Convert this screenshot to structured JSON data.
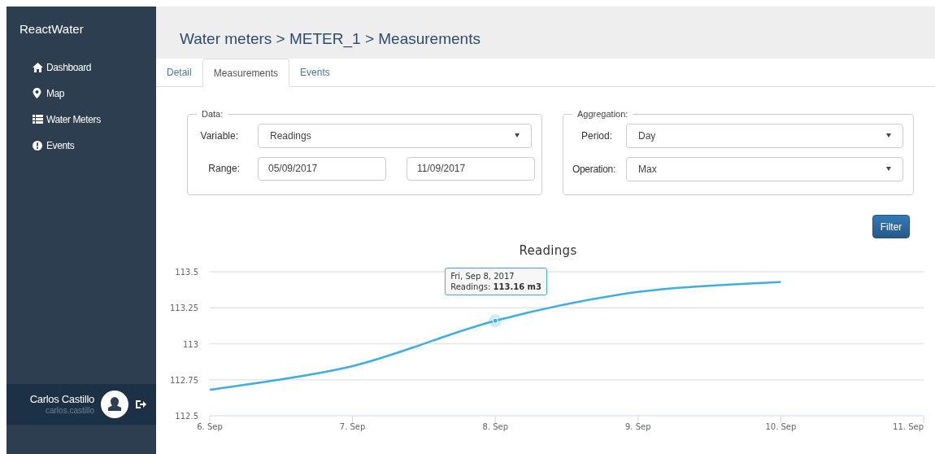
{
  "sidebar": {
    "brand": "ReactWater",
    "items": [
      {
        "kind": "home",
        "label": "Dashboard"
      },
      {
        "kind": "pin",
        "label": "Map"
      },
      {
        "kind": "list",
        "label": "Water Meters"
      },
      {
        "kind": "alert",
        "label": "Events"
      }
    ],
    "user": {
      "name": "Carlos Castillo",
      "username": "carlos.castillo"
    }
  },
  "header": {
    "breadcrumb": "Water meters > METER_1 > Measurements"
  },
  "tabs": [
    {
      "label": "Detail",
      "selected": false
    },
    {
      "label": "Measurements",
      "selected": true
    },
    {
      "label": "Events",
      "selected": false
    }
  ],
  "data_panel": {
    "legend": "Data:",
    "variable": {
      "label": "Variable:",
      "value": "Readings"
    },
    "range": {
      "label": "Range:",
      "from": "05/09/2017",
      "to": "11/09/2017"
    }
  },
  "aggregation_panel": {
    "legend": "Aggregation:",
    "period": {
      "label": "Period:",
      "value": "Day"
    },
    "operation": {
      "label": "Operation:",
      "value": "Max"
    }
  },
  "filter_button": "Filter",
  "chart": {
    "chart_data": {
      "type": "line",
      "title": "Readings",
      "categories": [
        "6. Sep",
        "7. Sep",
        "8. Sep",
        "9. Sep",
        "10. Sep",
        "11. Sep"
      ],
      "values": [
        112.68,
        112.845,
        113.16,
        113.36,
        113.43,
        null
      ],
      "ylim": [
        112.5,
        113.5
      ],
      "grid": true,
      "yticks": [
        {
          "value": 112.5,
          "label": "112.5"
        },
        {
          "value": 112.75,
          "label": "112.75"
        },
        {
          "value": 113,
          "label": "113"
        },
        {
          "value": 113.25,
          "label": "113.25"
        },
        {
          "value": 113.5,
          "label": "113.5"
        }
      ]
    },
    "tooltip": {
      "title": "Fri, Sep 8, 2017",
      "text": "Readings: **113.16 m3**"
    }
  }
}
